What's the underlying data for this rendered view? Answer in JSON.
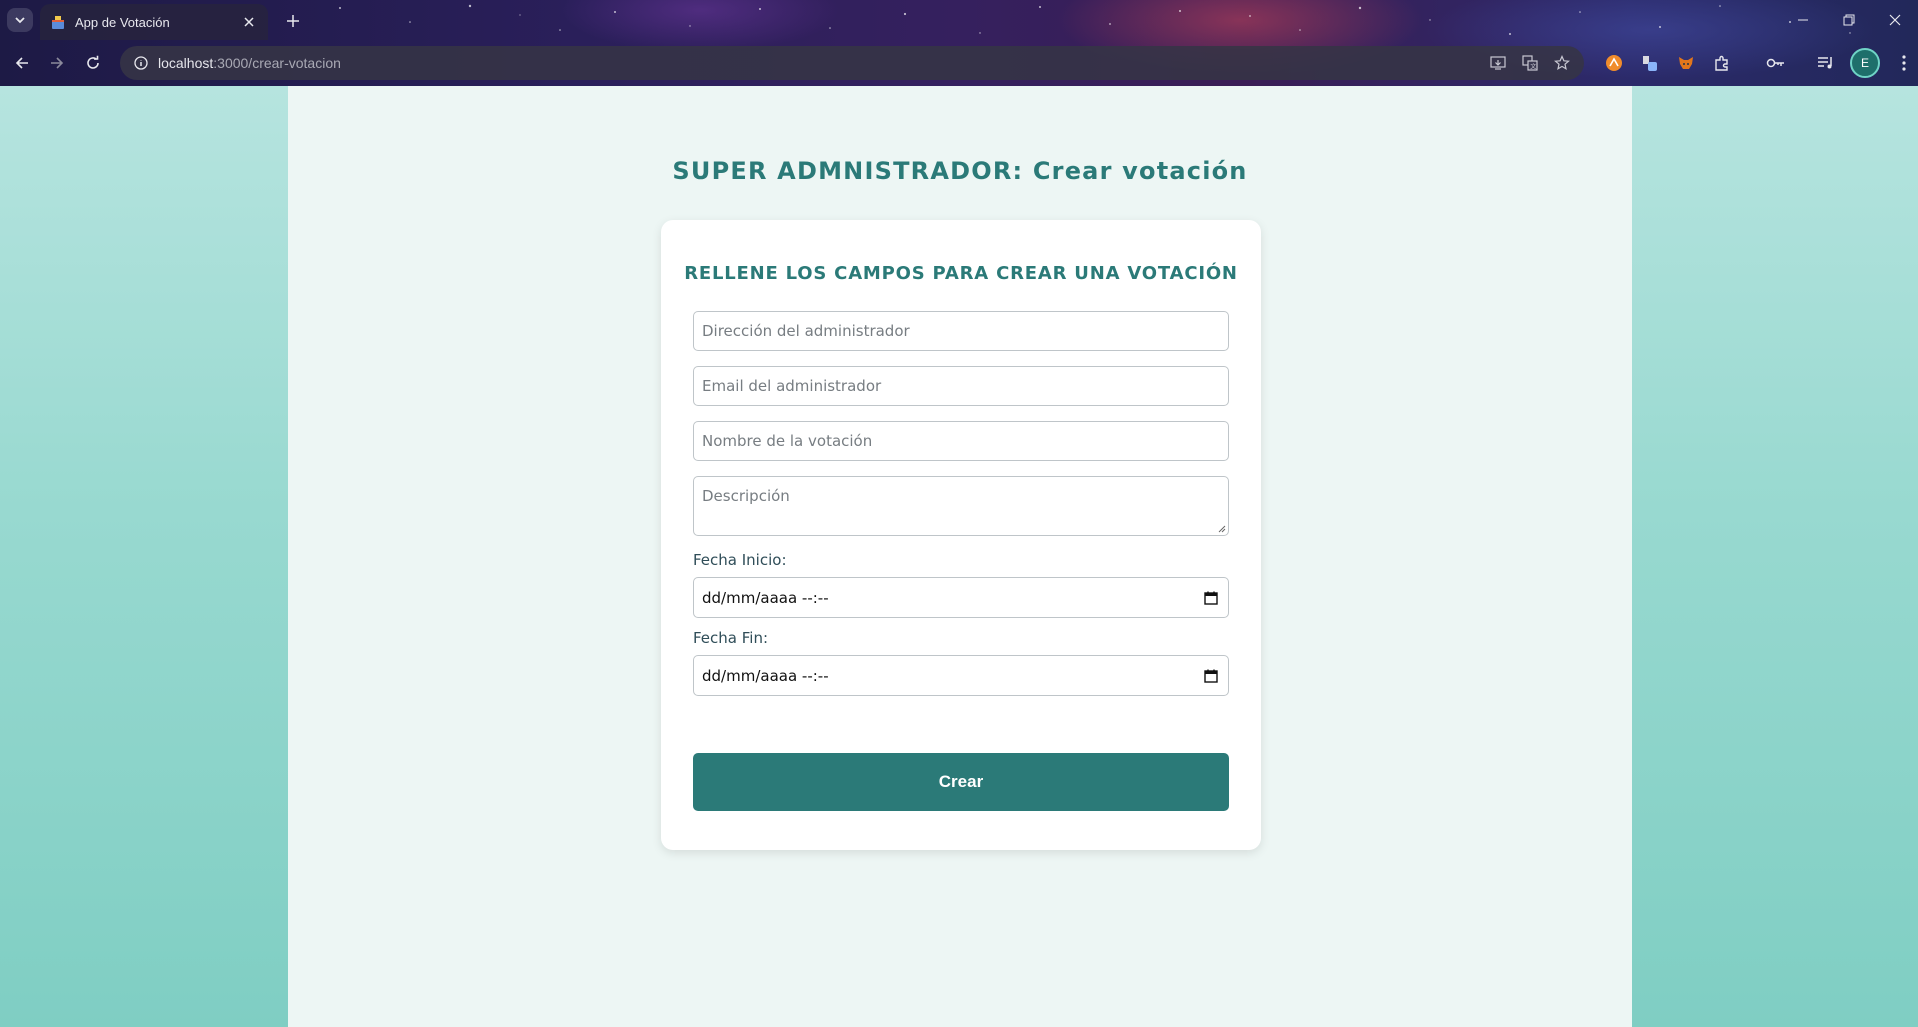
{
  "browser": {
    "tab_title": "App de Votación",
    "url_host": "localhost",
    "url_path": ":3000/crear-votacion",
    "profile_initial": "E"
  },
  "page": {
    "title": "SUPER ADMNISTRADOR: Crear votación",
    "card_title": "RELLENE LOS CAMPOS PARA CREAR UNA VOTACIÓN",
    "fields": {
      "admin_address_placeholder": "Dirección del administrador",
      "admin_email_placeholder": "Email del administrador",
      "vote_name_placeholder": "Nombre de la votación",
      "description_placeholder": "Descripción"
    },
    "start_label": "Fecha Inicio:",
    "start_value": "dd/mm/aaaa --:--",
    "end_label": "Fecha Fin:",
    "end_value": "dd/mm/aaaa --:--",
    "submit_label": "Crear"
  },
  "colors": {
    "accent": "#2b7a78",
    "page_bg": "#edf6f4",
    "viewport_bg": "#98d9d0"
  }
}
